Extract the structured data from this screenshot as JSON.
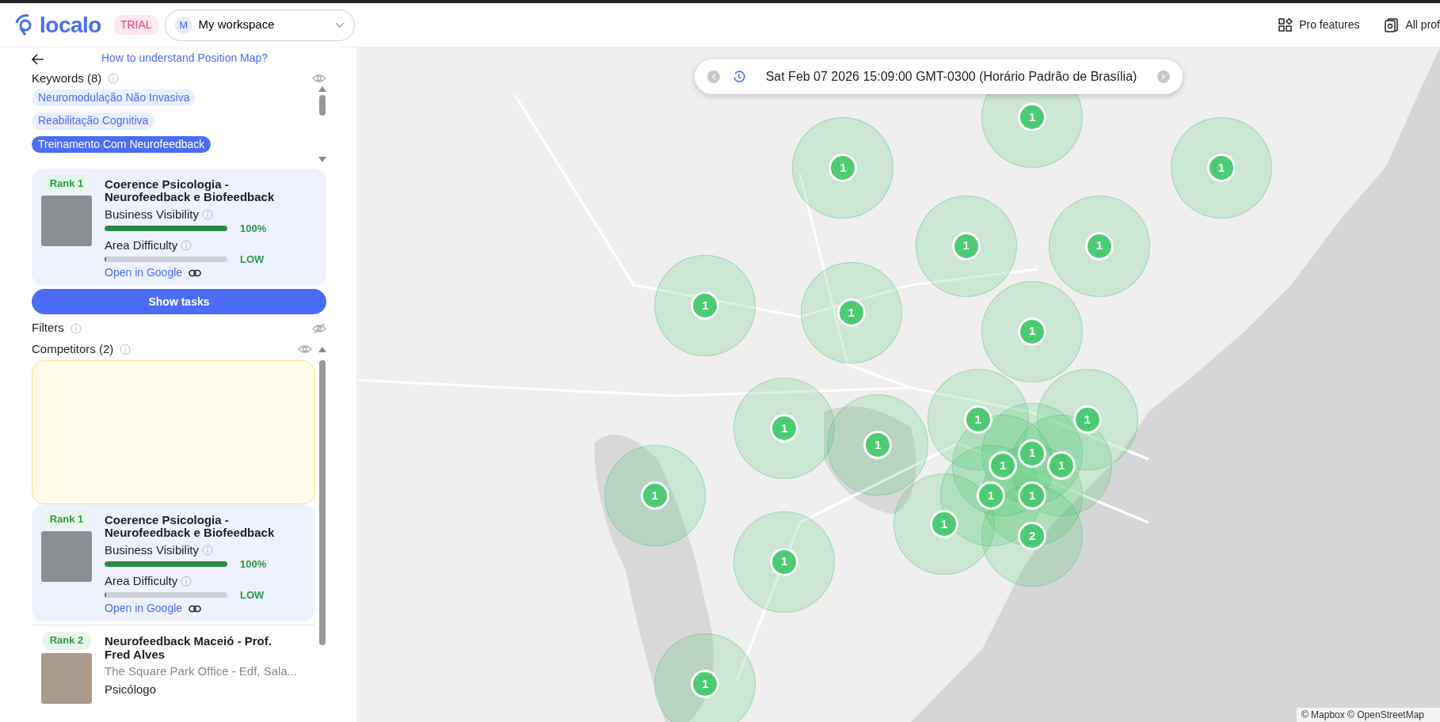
{
  "header": {
    "logo": "localo",
    "badge": "TRIAL",
    "workspace": {
      "initial": "M",
      "name": "My workspace"
    },
    "nav": [
      {
        "label": "Pro features",
        "kind": "grid"
      },
      {
        "label": "All prof",
        "kind": "copy"
      }
    ]
  },
  "sidebar": {
    "help_link": "How to understand Position Map?",
    "keywords": {
      "title": "Keywords (8)",
      "items": [
        {
          "label": "Neuromodulação Não Invasiva",
          "selected": false
        },
        {
          "label": "Reabilitação Cognitiva",
          "selected": false
        },
        {
          "label": "Treinamento Com Neurofeedback",
          "selected": true
        }
      ]
    },
    "business": {
      "rank": "Rank 1",
      "name": "Coerence Psicologia - Neurofeedback e Biofeedback",
      "visibility": {
        "label": "Business Visibility",
        "level": 1,
        "reading": "100%"
      },
      "difficulty": {
        "label": "Area Difficulty",
        "level": 0.01,
        "reading": "LOW"
      },
      "link": "Open in Google"
    },
    "show_tasks": "Show tasks",
    "filters": {
      "title": "Filters"
    },
    "competitors": {
      "title": "Competitors (2)",
      "items": [
        {
          "kind": "metrics",
          "selected": true,
          "rank": "Rank 1",
          "name": "Coerence Psicologia - Neurofeedback e Biofeedback",
          "visibility": {
            "label": "Business Visibility",
            "level": 1,
            "reading": "100%"
          },
          "difficulty": {
            "label": "Area Difficulty",
            "level": 0.01,
            "reading": "LOW"
          },
          "link": "Open in Google"
        },
        {
          "kind": "details",
          "selected": false,
          "rank": "Rank 2",
          "name": "Neurofeedback Maceió - Prof. Fred Alves",
          "address": "The Square Park Office - Edf, Sala...",
          "category": "Psicólogo"
        }
      ]
    }
  },
  "map": {
    "date": "Sat Feb 07 2026 15:09:00 GMT-0300 (Horário Padrão de Brasília)",
    "markers": [
      {
        "count": "1"
      },
      {
        "count": "1"
      },
      {
        "count": "1"
      },
      {
        "count": "1"
      },
      {
        "count": "1"
      },
      {
        "count": "1"
      },
      {
        "count": "1"
      },
      {
        "count": "1"
      },
      {
        "count": "1"
      },
      {
        "count": "1"
      },
      {
        "count": "1"
      },
      {
        "count": "1"
      },
      {
        "count": "1"
      },
      {
        "count": "1"
      },
      {
        "count": "1"
      },
      {
        "count": "1"
      },
      {
        "count": "1"
      },
      {
        "count": "1"
      },
      {
        "count": "1"
      },
      {
        "count": "2"
      },
      {
        "count": "1"
      },
      {
        "count": "1"
      }
    ],
    "attribution": "© Mapbox © OpenStreetMap"
  }
}
